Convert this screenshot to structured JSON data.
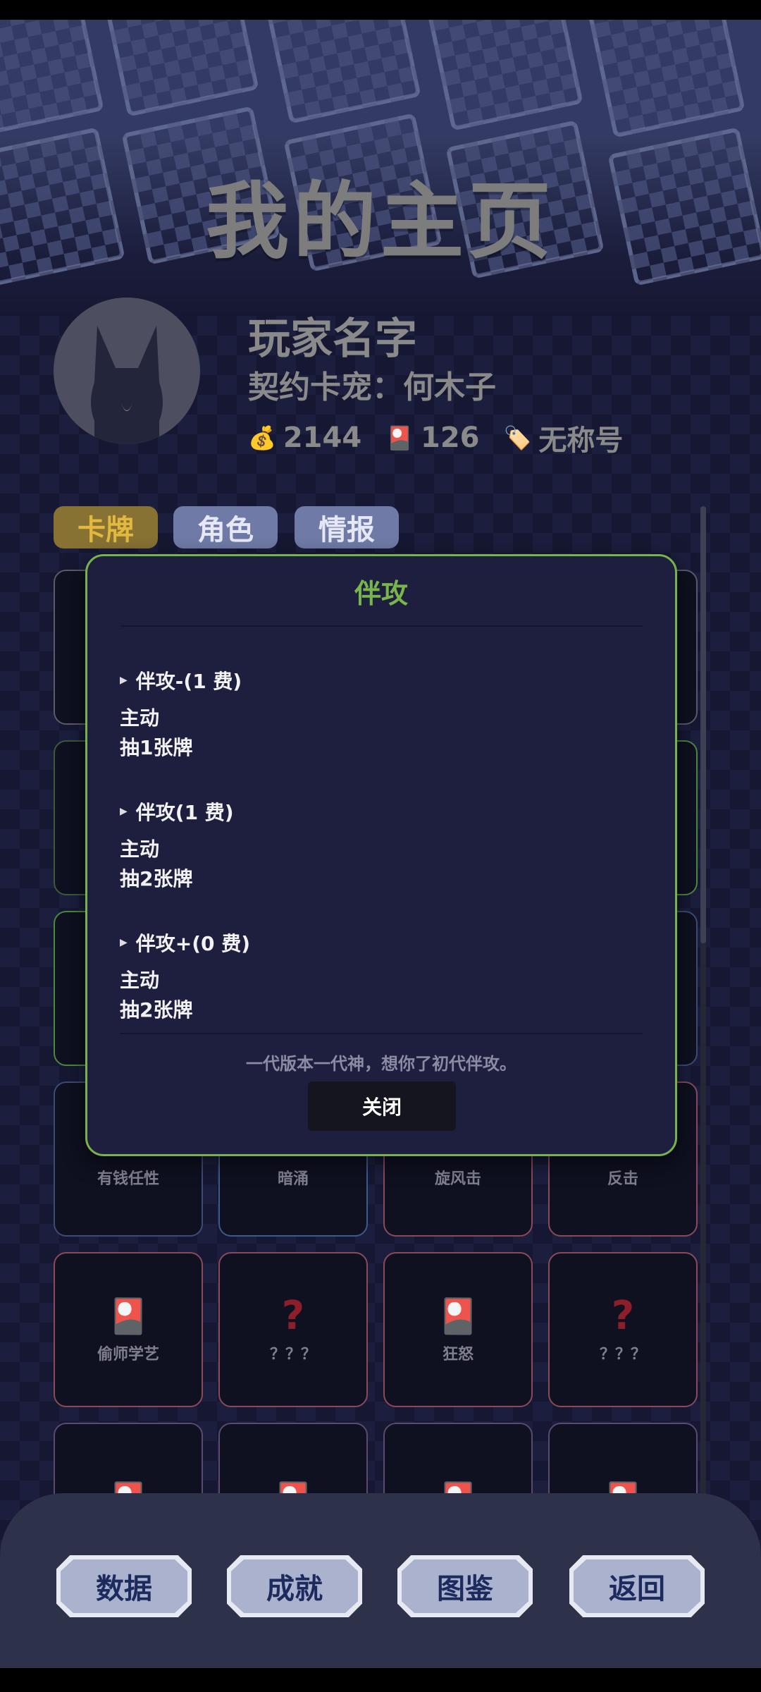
{
  "header": {
    "title": "我的主页"
  },
  "profile": {
    "player_name": "玩家名字",
    "pet_label": "契约卡宠：",
    "pet_name": "何木子",
    "coins": "2144",
    "cards": "126",
    "title": "无称号",
    "icons": {
      "coins": "money-bag-icon",
      "cards": "card-icon",
      "title": "tag-icon"
    }
  },
  "tabs": [
    {
      "label": "卡牌"
    },
    {
      "label": "角色"
    },
    {
      "label": "情报"
    }
  ],
  "grid": {
    "row4": [
      {
        "name": "有钱任性"
      },
      {
        "name": "暗涌"
      },
      {
        "name": "旋风击"
      },
      {
        "name": "反击"
      }
    ],
    "row5": [
      {
        "name": "偷师学艺"
      },
      {
        "name": "？？？"
      },
      {
        "name": "狂怒"
      },
      {
        "name": "？？？"
      }
    ]
  },
  "modal": {
    "title": "伴攻",
    "variants": [
      {
        "header": "伴攻-(1 费)",
        "lines": [
          "主动",
          "抽1张牌"
        ]
      },
      {
        "header": "伴攻(1 费)",
        "lines": [
          "主动",
          "抽2张牌"
        ]
      },
      {
        "header": "伴攻+(0 费)",
        "lines": [
          "主动",
          "抽2张牌"
        ]
      }
    ],
    "quote": "一代版本一代神，想你了初代伴攻。",
    "close_label": "关闭"
  },
  "bottom_nav": {
    "data": "数据",
    "achievements": "成就",
    "codex": "图鉴",
    "back": "返回"
  },
  "colors": {
    "accent_green": "#78b64b",
    "tab_active": "#877234",
    "tab_inactive": "#6f7aa6",
    "panel": "#1e1e3f"
  }
}
